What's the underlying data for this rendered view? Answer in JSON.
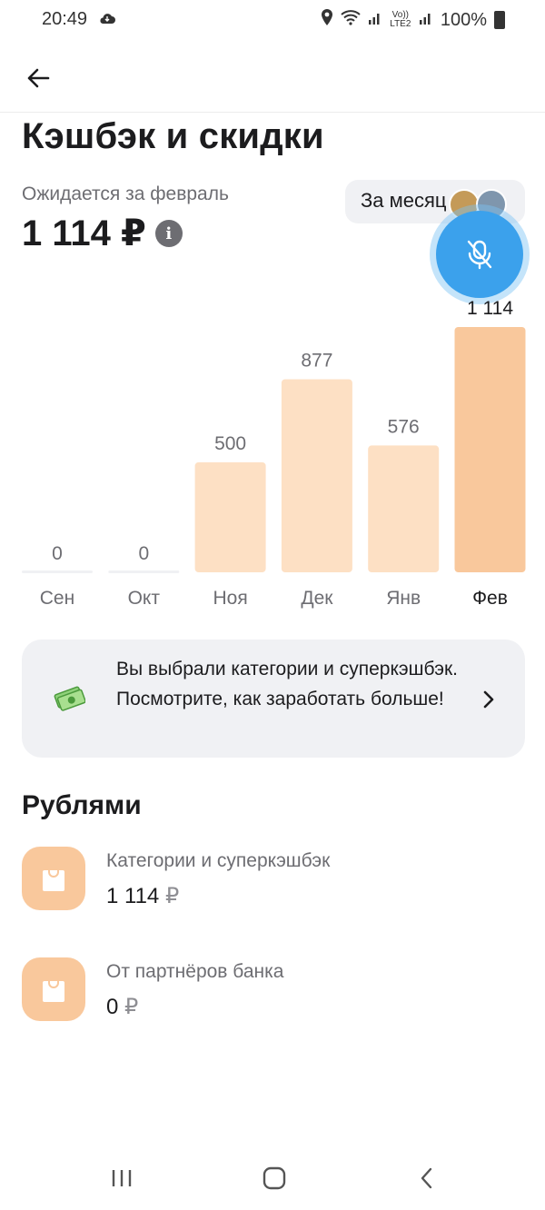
{
  "status_bar": {
    "time": "20:49",
    "signal_label": "Vo)) LTE2",
    "battery": "100%"
  },
  "page": {
    "title": "Кэшбэк и скидки",
    "expected_label": "Ожидается за февраль",
    "expected_amount": "1 114 ₽",
    "period_button": "За месяц"
  },
  "chart_data": {
    "type": "bar",
    "categories": [
      "Сен",
      "Окт",
      "Ноя",
      "Дек",
      "Янв",
      "Фев"
    ],
    "values": [
      0,
      0,
      500,
      877,
      576,
      1114
    ],
    "value_labels": [
      "0",
      "0",
      "500",
      "877",
      "576",
      "1 114"
    ],
    "highlighted_index": 5,
    "ylim": [
      0,
      1114
    ],
    "colors": {
      "bar": "#fde0c4",
      "bar_active": "#f9c89c",
      "baseline": "#f0f1f4",
      "label": "#6d6d72"
    }
  },
  "promo": {
    "text": "Вы выбрали категории и суперкэшбэк. Посмотрите, как заработать больше!",
    "icon": "money-icon"
  },
  "section": {
    "title": "Рублями",
    "items": [
      {
        "label": "Категории и суперкэшбэк",
        "amount": "1 114",
        "currency": "₽",
        "icon": "shopping-bag-icon"
      },
      {
        "label": "От партнёров банка",
        "amount": "0",
        "currency": "₽",
        "icon": "shopping-bag-icon"
      }
    ]
  },
  "colors": {
    "accent": "#f9c89c",
    "overlay": "#3ba1ec"
  }
}
